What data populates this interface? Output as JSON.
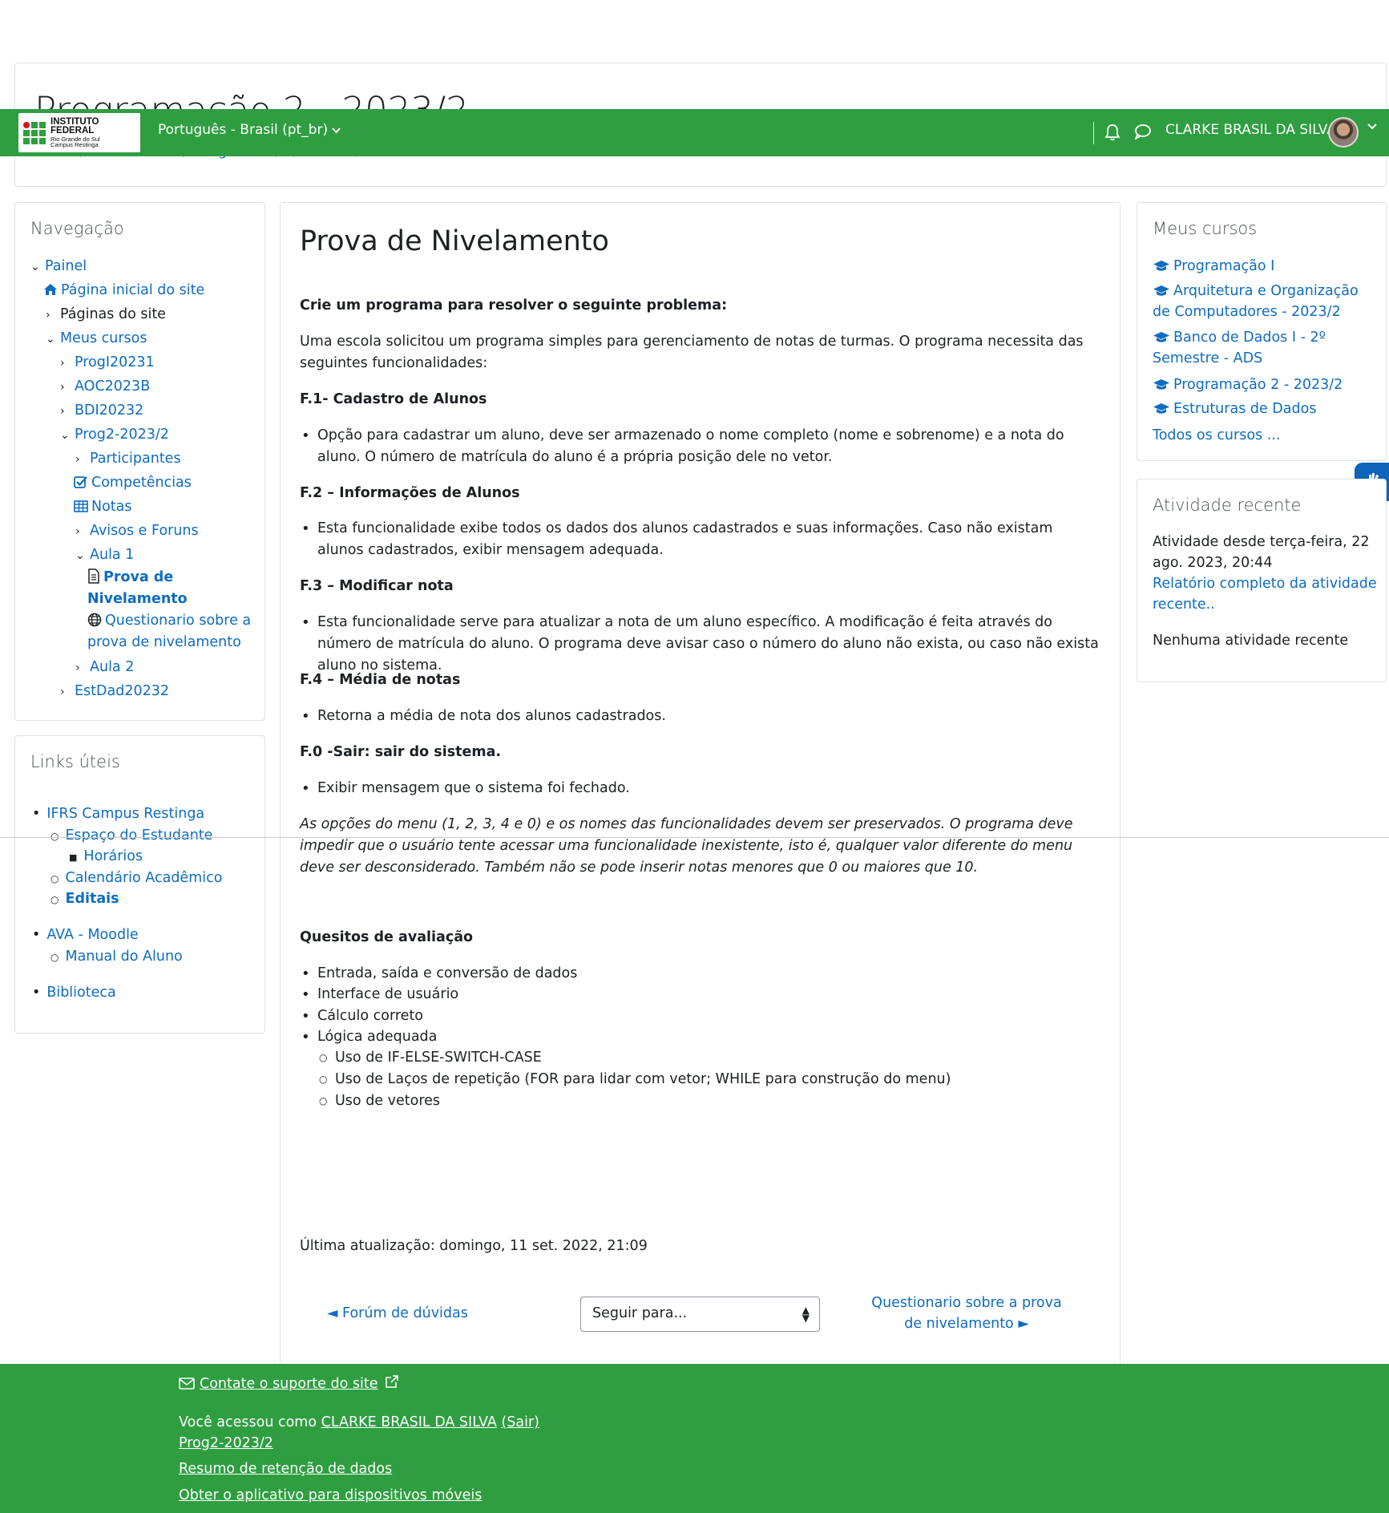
{
  "header": {
    "course_title": "Programação 2 - 2023/2",
    "breadcrumb": [
      "Painel",
      "Meus cursos",
      "Prog2-2023/2",
      "Aula 1",
      "Prova de Nivelamento"
    ]
  },
  "navbar": {
    "logo_line1": "INSTITUTO FEDERAL",
    "logo_line2": "Rio Grande do Sul",
    "logo_line3": "Campus Restinga",
    "language": "Português - Brasil (pt_br)",
    "user_name": "CLARKE BRASIL DA SILVA",
    "brand_color": "#2f9e41"
  },
  "navigation": {
    "title": "Navegação",
    "items": [
      {
        "label": "Painel"
      },
      {
        "label": "Página inicial do site"
      },
      {
        "label": "Páginas do site"
      },
      {
        "label": "Meus cursos"
      },
      {
        "label": "ProgI20231"
      },
      {
        "label": "AOC2023B"
      },
      {
        "label": "BDI20232"
      },
      {
        "label": "Prog2-2023/2"
      },
      {
        "label": "Participantes"
      },
      {
        "label": "Competências"
      },
      {
        "label": "Notas"
      },
      {
        "label": "Avisos e Foruns"
      },
      {
        "label": "Aula 1"
      },
      {
        "label": "Prova de Nivelamento"
      },
      {
        "label": "Questionario sobre a prova de nivelamento"
      },
      {
        "label": "Aula 2"
      },
      {
        "label": "EstDad20232"
      }
    ]
  },
  "links": {
    "title": "Links úteis",
    "items": [
      "IFRS Campus Restinga",
      "Espaço do Estudante",
      "Horários",
      "Calendário Acadêmico",
      "Editais",
      "AVA - Moodle",
      "Manual do Aluno",
      "Biblioteca"
    ]
  },
  "main": {
    "page_title": "Prova de Nivelamento",
    "intro_heading": "Crie um programa para resolver o seguinte problema:",
    "intro_text": "Uma escola solicitou um programa simples para gerenciamento de notas de turmas. O programa necessita das seguintes funcionalidades:",
    "f1_title": "F.1- Cadastro de Alunos",
    "f1_item": "Opção para cadastrar um aluno, deve ser armazenado o nome completo (nome e sobrenome) e a nota do aluno. O número de matrícula do aluno é a própria posição dele no vetor.",
    "f2_title": "F.2 – Informações de Alunos",
    "f2_item": "Esta funcionalidade exibe todos os dados dos alunos cadastrados e suas informações. Caso não existam alunos cadastrados, exibir mensagem adequada.",
    "f3_title": "F.3 – Modificar nota",
    "f3_item": "Esta funcionalidade serve para atualizar a nota de um aluno específico. A modificação é feita através do número de matrícula do aluno. O programa deve avisar caso o número do aluno não exista, ou caso não exista aluno no sistema.",
    "f4_title": "F.4 – Média de notas",
    "f4_item": "Retorna a média de nota dos alunos cadastrados.",
    "f0_title": "F.0 -Sair: sair do sistema.",
    "f0_item": "Exibir mensagem que o sistema foi fechado.",
    "note": "As opções do menu (1, 2, 3, 4 e 0) e os nomes das funcionalidades devem ser preservados. O programa deve impedir que o usuário tente acessar uma funcionalidade inexistente, isto é, qualquer valor diferente do menu deve ser desconsiderado. Também não se pode inserir notas menores que 0 ou maiores que 10.",
    "criteria_title": "Quesitos de avaliação",
    "criteria": [
      "Entrada, saída e conversão de dados",
      "Interface de usuário",
      "Cálculo correto",
      "Lógica adequada"
    ],
    "criteria_sub": [
      "Uso de IF-ELSE-SWITCH-CASE",
      "Uso de Laços de repetição (FOR para lidar com vetor; WHILE para construção do menu)",
      "Uso de vetores"
    ],
    "last_modified": "Última atualização: domingo, 11 set. 2022, 21:09",
    "prev_link": "◄ Forúm de dúvidas",
    "jump_placeholder": "Seguir para...",
    "next_link": "Questionario sobre a prova de nivelamento ►"
  },
  "my_courses": {
    "title": "Meus cursos",
    "items": [
      "Programação I",
      "Arquitetura e Organização de Computadores - 2023/2",
      "Banco de Dados I - 2º Semestre - ADS",
      "Programação 2 - 2023/2",
      "Estruturas de Dados"
    ],
    "all_courses": "Todos os cursos ..."
  },
  "recent_activity": {
    "title": "Atividade recente",
    "since": "Atividade desde terça-feira, 22 ago. 2023, 20:44",
    "full_report": "Relatório completo da atividade recente..",
    "none": "Nenhuma atividade recente"
  },
  "footer": {
    "contact": "Contate o suporte do site",
    "logged_prefix": "Você acessou como ",
    "logged_user": "CLARKE BRASIL DA SILVA",
    "logout": "(Sair)",
    "course": "Prog2-2023/2",
    "data_retention": "Resumo de retenção de dados",
    "mobile_app": "Obter o aplicativo para dispositivos móveis"
  }
}
